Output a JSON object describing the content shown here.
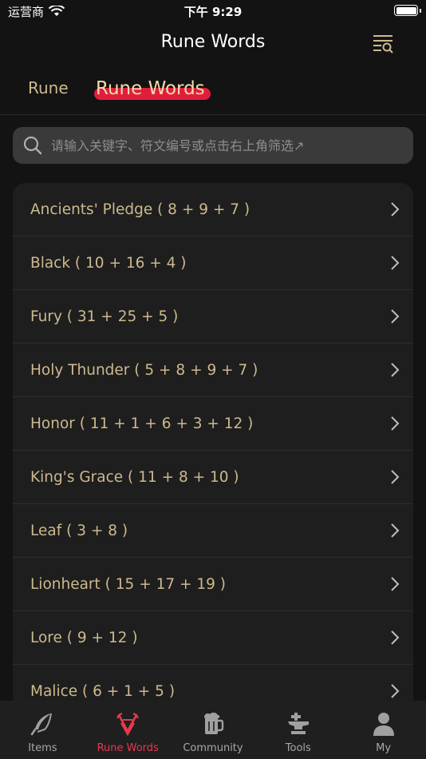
{
  "status_bar": {
    "carrier": "运营商",
    "time": "下午 9:29"
  },
  "nav": {
    "title": "Rune Words"
  },
  "tabs": [
    {
      "label": "Rune",
      "active": false
    },
    {
      "label": "Rune Words",
      "active": true
    }
  ],
  "search": {
    "placeholder": "请输入关键字、符文编号或点击右上角筛选↗",
    "value": ""
  },
  "list": [
    {
      "label": "Ancients' Pledge ( 8 + 9 + 7 )"
    },
    {
      "label": "Black ( 10 + 16 + 4 )"
    },
    {
      "label": "Fury ( 31 + 25 + 5 )"
    },
    {
      "label": "Holy Thunder ( 5 + 8 + 9 + 7 )"
    },
    {
      "label": "Honor ( 11 + 1 + 6 + 3 + 12 )"
    },
    {
      "label": "King's Grace ( 11 + 8 + 10 )"
    },
    {
      "label": "Leaf ( 3 + 8 )"
    },
    {
      "label": "Lionheart ( 15 + 17 + 19 )"
    },
    {
      "label": "Lore ( 9 + 12 )"
    },
    {
      "label": "Malice ( 6 + 1 + 5 )"
    }
  ],
  "tab_bar": [
    {
      "label": "Items",
      "icon": "feather-icon",
      "active": false
    },
    {
      "label": "Rune Words",
      "icon": "rune-symbol-icon",
      "active": true
    },
    {
      "label": "Community",
      "icon": "beer-mug-icon",
      "active": false
    },
    {
      "label": "Tools",
      "icon": "anvil-icon",
      "active": false
    },
    {
      "label": "My",
      "icon": "person-icon",
      "active": false
    }
  ],
  "colors": {
    "accent": "#e01e3c",
    "gold_text": "#cdb98e",
    "background": "#131313",
    "row_bg": "#1e1e1e"
  }
}
